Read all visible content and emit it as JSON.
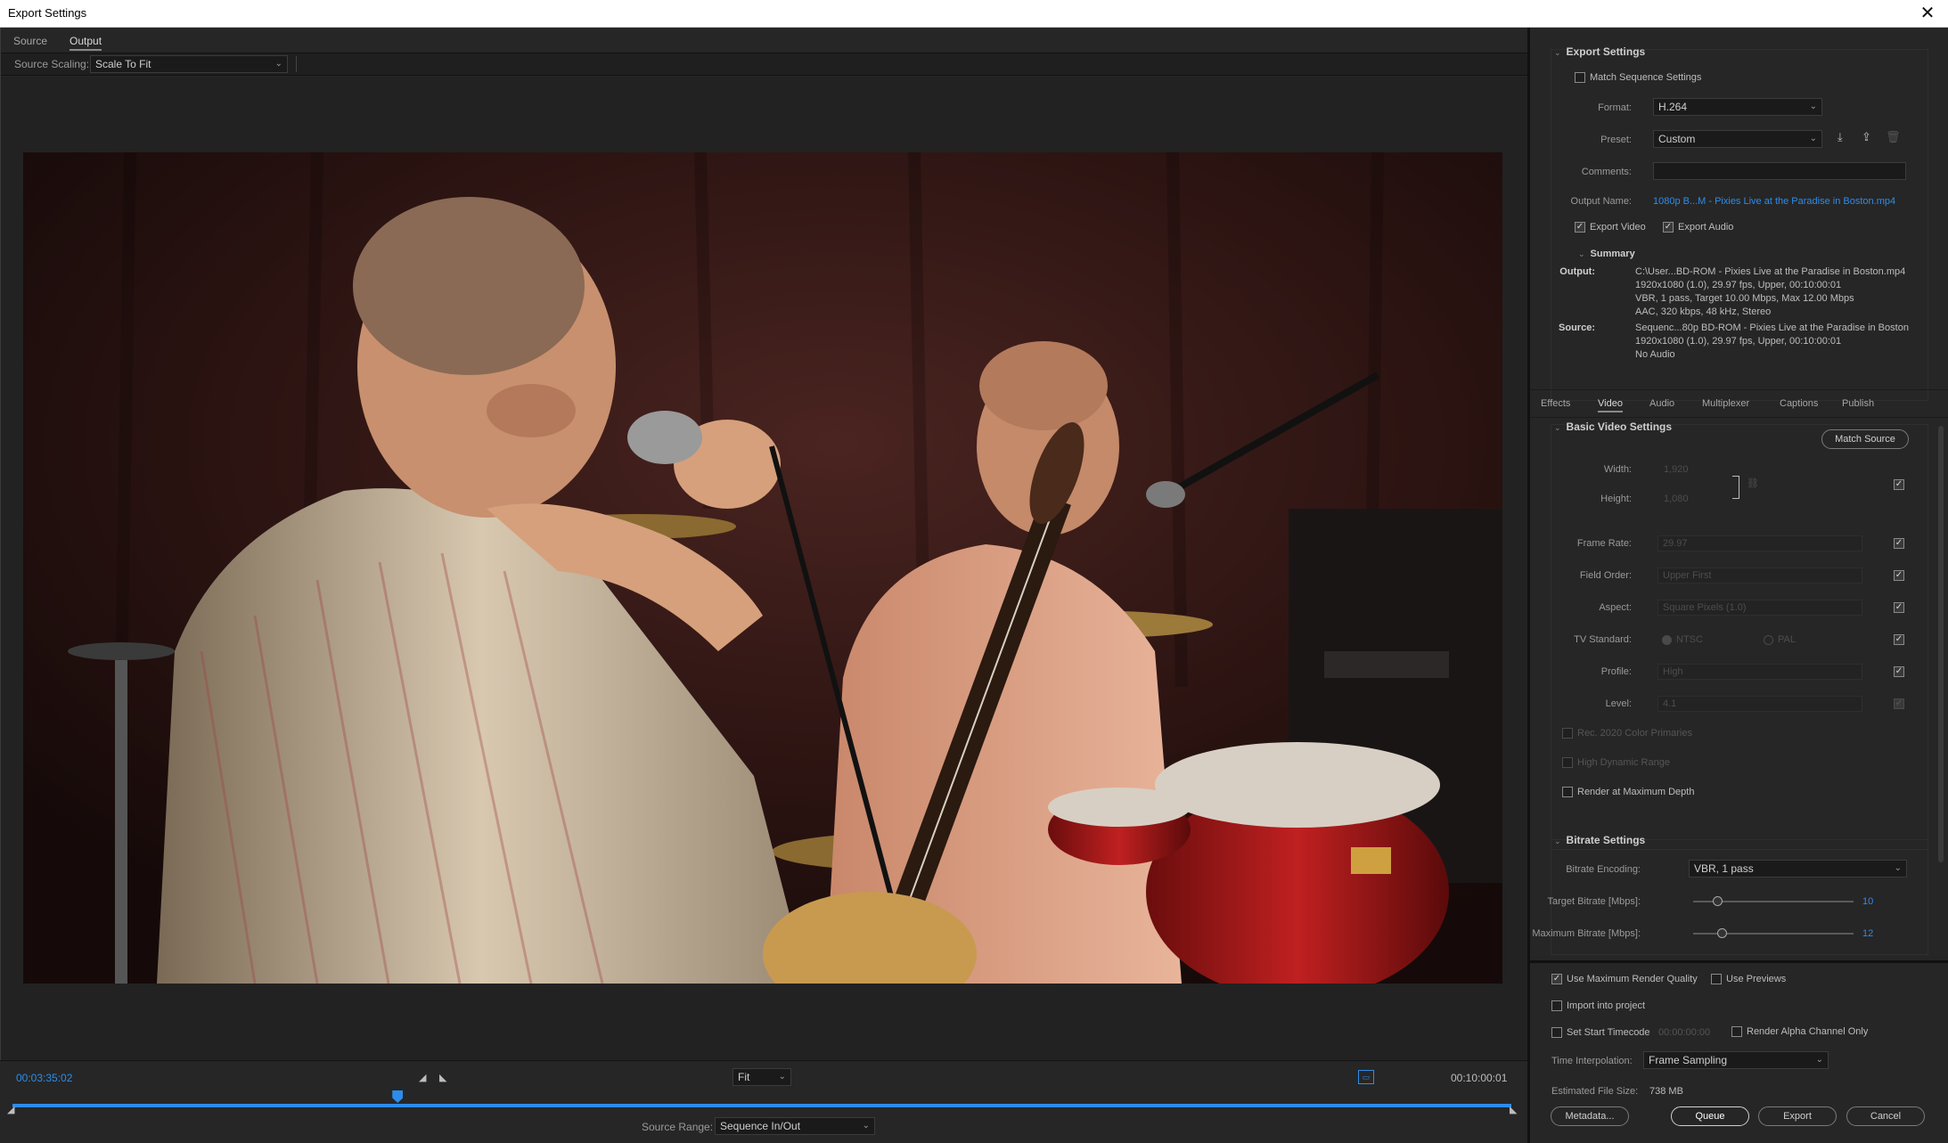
{
  "window": {
    "title": "Export Settings",
    "close_glyph": "✕"
  },
  "left": {
    "tabs": [
      {
        "label": "Source"
      },
      {
        "label": "Output"
      }
    ],
    "scaling": {
      "label": "Source Scaling:",
      "value": "Scale To Fit"
    },
    "timeline": {
      "current_tc": "00:03:35:02",
      "end_tc": "00:10:00:01",
      "zoom": "Fit",
      "range_label": "Source Range:",
      "range_value": "Sequence In/Out",
      "playhead_fraction": 0.257
    }
  },
  "export_settings": {
    "heading": "Export Settings",
    "match_sequence": {
      "label": "Match Sequence Settings",
      "checked": false
    },
    "format": {
      "label": "Format:",
      "value": "H.264"
    },
    "preset": {
      "label": "Preset:",
      "value": "Custom"
    },
    "comments": {
      "label": "Comments:",
      "value": ""
    },
    "output_name": {
      "label": "Output Name:",
      "value": "1080p B...M - Pixies Live at the Paradise in Boston.mp4"
    },
    "export_video": {
      "label": "Export Video",
      "checked": true
    },
    "export_audio": {
      "label": "Export Audio",
      "checked": true
    },
    "summary": {
      "heading": "Summary",
      "output_key": "Output:",
      "output_lines": [
        "C:\\User...BD-ROM - Pixies Live at the Paradise in Boston.mp4",
        "1920x1080 (1.0), 29.97 fps, Upper, 00:10:00:01",
        "VBR, 1 pass, Target 10.00 Mbps, Max 12.00 Mbps",
        "AAC, 320 kbps, 48 kHz, Stereo"
      ],
      "source_key": "Source:",
      "source_lines": [
        "Sequenc...80p BD-ROM - Pixies Live at the Paradise in Boston",
        "1920x1080 (1.0), 29.97 fps, Upper, 00:10:00:01",
        "No Audio"
      ]
    }
  },
  "tabs2": [
    {
      "label": "Effects"
    },
    {
      "label": "Video"
    },
    {
      "label": "Audio"
    },
    {
      "label": "Multiplexer"
    },
    {
      "label": "Captions"
    },
    {
      "label": "Publish"
    }
  ],
  "basic_video": {
    "heading": "Basic Video Settings",
    "match_source": "Match Source",
    "width": {
      "label": "Width:",
      "value": "1,920"
    },
    "height": {
      "label": "Height:",
      "value": "1,080"
    },
    "frame_rate": {
      "label": "Frame Rate:",
      "value": "29.97"
    },
    "field_order": {
      "label": "Field Order:",
      "value": "Upper First"
    },
    "aspect": {
      "label": "Aspect:",
      "value": "Square Pixels (1.0)"
    },
    "tv_standard": {
      "label": "TV Standard:",
      "ntsc": "NTSC",
      "pal": "PAL"
    },
    "profile": {
      "label": "Profile:",
      "value": "High"
    },
    "level": {
      "label": "Level:",
      "value": "4.1"
    },
    "rec2020": "Rec. 2020 Color Primaries",
    "hdr": "High Dynamic Range",
    "render_max_depth": "Render at Maximum Depth"
  },
  "bitrate": {
    "heading": "Bitrate Settings",
    "encoding": {
      "label": "Bitrate Encoding:",
      "value": "VBR, 1 pass"
    },
    "target": {
      "label": "Target Bitrate [Mbps]:",
      "value": "10",
      "fraction": 0.15
    },
    "maximum": {
      "label": "Maximum Bitrate [Mbps]:",
      "value": "12",
      "fraction": 0.18
    }
  },
  "bottom": {
    "use_max_render_quality": {
      "label": "Use Maximum Render Quality",
      "checked": true
    },
    "use_previews": {
      "label": "Use Previews",
      "checked": false
    },
    "import_into_project": {
      "label": "Import into project",
      "checked": false
    },
    "set_start_timecode": {
      "label": "Set Start Timecode",
      "value": "00:00:00:00",
      "checked": false
    },
    "render_alpha": {
      "label": "Render Alpha Channel Only",
      "checked": false
    },
    "time_interpolation": {
      "label": "Time Interpolation:",
      "value": "Frame Sampling"
    },
    "file_size": {
      "label": "Estimated File Size:",
      "value": "738 MB"
    },
    "buttons": {
      "metadata": "Metadata...",
      "queue": "Queue",
      "export": "Export",
      "cancel": "Cancel"
    }
  },
  "colors": {
    "accent": "#2d8ceb",
    "background": "#262626",
    "panel": "#1d1d1d"
  }
}
